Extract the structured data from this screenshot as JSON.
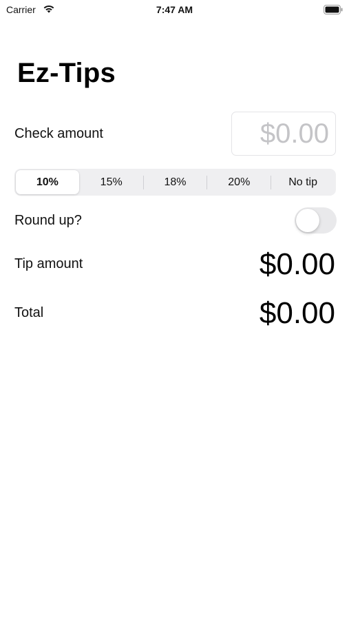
{
  "status_bar": {
    "carrier": "Carrier",
    "time": "7:47 AM",
    "wifi_icon": "wifi-icon",
    "battery_icon": "battery-icon"
  },
  "app": {
    "title": "Ez-Tips"
  },
  "check": {
    "label": "Check amount",
    "placeholder": "$0.00",
    "value": ""
  },
  "tip_options": {
    "items": [
      "10%",
      "15%",
      "18%",
      "20%",
      "No tip"
    ],
    "selected": "10%"
  },
  "round_up": {
    "label": "Round up?",
    "on": false
  },
  "tip": {
    "label": "Tip amount",
    "value": "$0.00"
  },
  "total": {
    "label": "Total",
    "value": "$0.00"
  },
  "colors": {
    "segment_background": "#efeff1",
    "toggle_off": "#e9e9eb",
    "placeholder": "#c4c4c7"
  }
}
